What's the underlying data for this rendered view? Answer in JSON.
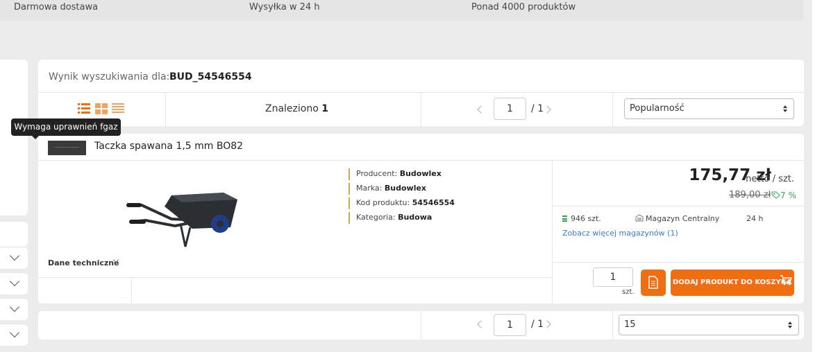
{
  "topbar": {
    "item1": "Darmowa dostawa",
    "item2": "Wysyłka w 24 h",
    "item3": "Ponad 4000 produktów"
  },
  "search": {
    "label": "Wynik wyszukiwania dla:",
    "term": "BUD_54546554"
  },
  "results": {
    "found_label": "Znaleziono",
    "found_count": "1"
  },
  "pagination": {
    "current_page": "1",
    "total": "/ 1"
  },
  "sort": {
    "selected": "Popularność"
  },
  "per_page": {
    "selected": "15"
  },
  "tooltip": {
    "text": "Wymaga uprawnień fgaz"
  },
  "product": {
    "name": "Taczka spawana 1,5 mm BO82",
    "attrs": [
      {
        "label": "Producent:",
        "value": "Budowlex"
      },
      {
        "label": "Marka:",
        "value": "Budowlex"
      },
      {
        "label": "Kod produktu:",
        "value": "54546554"
      },
      {
        "label": "Kategoria:",
        "value": "Budowa"
      }
    ],
    "price": "175,77 zł",
    "price_unit": "netto / szt.",
    "old_price": "189,00 zł",
    "discount": "7 %",
    "stock_qty": "946 szt.",
    "warehouse": "Magazyn Centralny",
    "delivery": "24 h",
    "more_warehouses": "Zobacz więcej magazynów (1)",
    "qty": "1",
    "qty_unit": "szt.",
    "add_to_cart": "DODAJ PRODUKT DO KOSZYKA",
    "tech_label": "Dane techniczne"
  },
  "colors": {
    "accent": "#f06d12",
    "discount": "#2fa84f",
    "link": "#3a7bd5"
  }
}
